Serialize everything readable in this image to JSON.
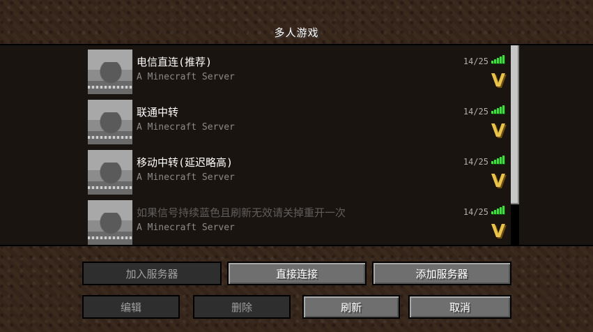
{
  "screen": {
    "title": "多人游戏"
  },
  "servers": [
    {
      "name": "电信直连(推荐)",
      "motd": "A Minecraft Server",
      "players": "14/25"
    },
    {
      "name": "联通中转",
      "motd": "A Minecraft Server",
      "players": "14/25"
    },
    {
      "name": "移动中转(延迟略高)",
      "motd": "A Minecraft Server",
      "players": "14/25"
    },
    {
      "name": "如果信号持续蓝色且刷新无效请关掉重开一次",
      "motd": "A Minecraft Server",
      "players": "14/25"
    }
  ],
  "version_marker": "V",
  "colors": {
    "signal": "#3ee03e",
    "version": "#e8c24a"
  },
  "buttons": {
    "join": "加入服务器",
    "direct": "直接连接",
    "add": "添加服务器",
    "edit": "编辑",
    "delete": "删除",
    "refresh": "刷新",
    "cancel": "取消"
  }
}
